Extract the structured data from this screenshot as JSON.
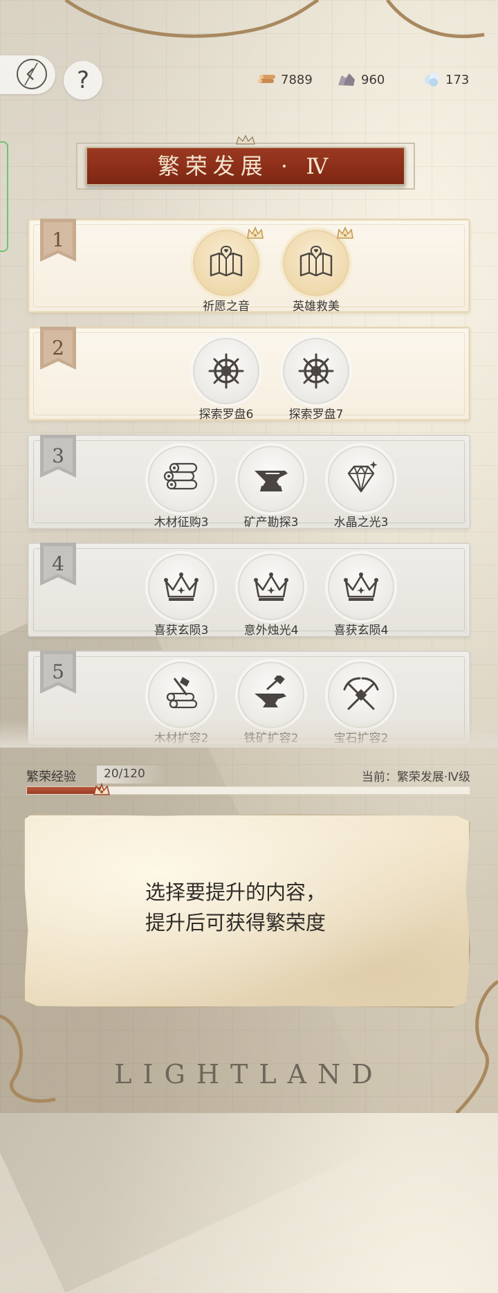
{
  "resources": {
    "wood": "7889",
    "ore": "960",
    "crystal": "173"
  },
  "banner": {
    "title": "繁荣发展 · Ⅳ"
  },
  "rows": [
    {
      "number": "1",
      "state": "unlocked",
      "items": [
        {
          "label": "祈愿之音",
          "icon": "map-heart-icon",
          "style": "gold",
          "crown": true
        },
        {
          "label": "英雄救美",
          "icon": "map-heart-icon",
          "style": "gold",
          "crown": true
        }
      ]
    },
    {
      "number": "2",
      "state": "unlocked",
      "items": [
        {
          "label": "探索罗盘6",
          "icon": "ship-wheel-icon",
          "style": "grey",
          "crown": false
        },
        {
          "label": "探索罗盘7",
          "icon": "ship-wheel-icon",
          "style": "grey",
          "crown": false
        }
      ]
    },
    {
      "number": "3",
      "state": "locked",
      "items": [
        {
          "label": "木材征购3",
          "icon": "logs-icon",
          "style": "grey",
          "crown": false
        },
        {
          "label": "矿产勘探3",
          "icon": "anvil-icon",
          "style": "grey",
          "crown": false
        },
        {
          "label": "水晶之光3",
          "icon": "diamond-icon",
          "style": "grey",
          "crown": false
        }
      ]
    },
    {
      "number": "4",
      "state": "locked",
      "items": [
        {
          "label": "喜获玄陨3",
          "icon": "crown-icon",
          "style": "grey",
          "crown": false
        },
        {
          "label": "意外烛光4",
          "icon": "crown-icon",
          "style": "grey",
          "crown": false
        },
        {
          "label": "喜获玄陨4",
          "icon": "crown-icon",
          "style": "grey",
          "crown": false
        }
      ]
    },
    {
      "number": "5",
      "state": "locked",
      "items": [
        {
          "label": "木材扩容2",
          "icon": "axe-logs-icon",
          "style": "grey",
          "crown": false
        },
        {
          "label": "铁矿扩容2",
          "icon": "hammer-anvil-icon",
          "style": "grey",
          "crown": false
        },
        {
          "label": "宝石扩容2",
          "icon": "crossed-pickaxes-icon",
          "style": "grey",
          "crown": false
        }
      ]
    }
  ],
  "progress": {
    "label": "繁荣经验",
    "value_text": "20/120",
    "current": 20,
    "max": 120,
    "current_level_text": "当前：繁荣发展·Ⅳ级"
  },
  "message": {
    "line1": "选择要提升的内容，",
    "line2": "提升后可获得繁荣度"
  },
  "logo": "LIGHTLAND",
  "colors": {
    "banner_red": "#8a2d18",
    "progress_fill": "#9a3d24",
    "gold_circle": "#efd9ad"
  }
}
